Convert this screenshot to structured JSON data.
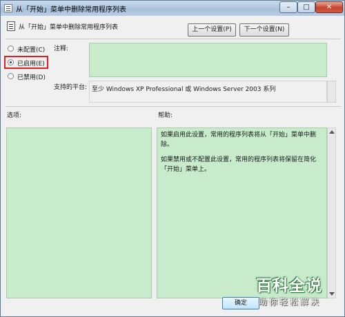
{
  "window": {
    "title": "从「开始」菜单中删除常用程序列表",
    "minimize": "–",
    "maximize": "□",
    "close": "✕"
  },
  "header": {
    "title": "从「开始」菜单中删除常用程序列表",
    "prev_button": "上一个设置(P)",
    "next_button": "下一个设置(N)"
  },
  "state": {
    "options": [
      {
        "label": "未配置(C)",
        "selected": false
      },
      {
        "label": "已启用(E)",
        "selected": true
      },
      {
        "label": "已禁用(D)",
        "selected": false
      }
    ]
  },
  "comment": {
    "label": "注释:",
    "value": ""
  },
  "platform": {
    "label": "支持的平台:",
    "value": "至少 Windows XP Professional 或 Windows Server 2003 系列"
  },
  "options_pane": {
    "label": "选项:"
  },
  "help_pane": {
    "label": "帮助:",
    "paragraphs": [
      "如果启用此设置，常用的程序列表将从「开始」菜单中删除。",
      "如果禁用或不配置此设置，常用的程序列表将保留在简化「开始」菜单上。"
    ]
  },
  "footer": {
    "ok_button": "确定"
  },
  "watermark": {
    "line1": "百科全说",
    "line2": "助你轻松解决"
  },
  "colors": {
    "pane_green": "#c7ebcb",
    "highlight_red": "#e02020"
  }
}
